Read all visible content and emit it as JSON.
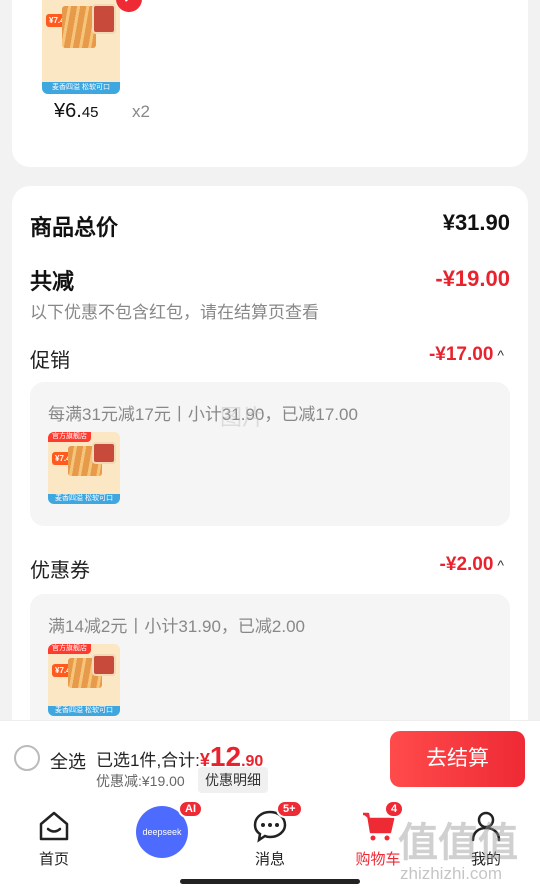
{
  "top_item": {
    "thumb_badge": "官方旗舰店",
    "thumb_price": "¥7.45",
    "thumb_strip": "麦香四溢 松软可口",
    "price_int": "¥6.",
    "price_dec": "45",
    "qty": "x2"
  },
  "summary": {
    "goods_total_label": "商品总价",
    "goods_total_value": "¥31.90",
    "total_reduce_label": "共减",
    "total_reduce_value": "-¥19.00",
    "note": "以下优惠不包含红包，请在结算页查看"
  },
  "promotion": {
    "label": "促销",
    "value": "-¥17.00",
    "caret": "^",
    "detail": "每满31元减17元丨小计31.90，已减17.00"
  },
  "coupon": {
    "label": "优惠券",
    "value": "-¥2.00",
    "caret": "^",
    "detail": "满14减2元丨小计31.90，已减2.00"
  },
  "bottom_bar": {
    "select_all": "全选",
    "selected_total_prefix": "已选1件,合计:",
    "currency": "¥",
    "total_int": "12",
    "total_dec": ".90",
    "discount": "优惠减:¥19.00",
    "detail_button": "优惠明细",
    "checkout": "去结算"
  },
  "tabbar": {
    "home": "首页",
    "deepseek": "deepseek",
    "deepseek_badge": "AI",
    "messages": "消息",
    "messages_badge": "5+",
    "cart": "购物车",
    "cart_badge": "4",
    "mine": "我的"
  },
  "watermark": {
    "main": "值值值",
    "sub": "zhizhizhi.com",
    "faint": "图片"
  },
  "colors": {
    "accent": "#e8232e",
    "deepseek_blue": "#4d6bfe"
  }
}
